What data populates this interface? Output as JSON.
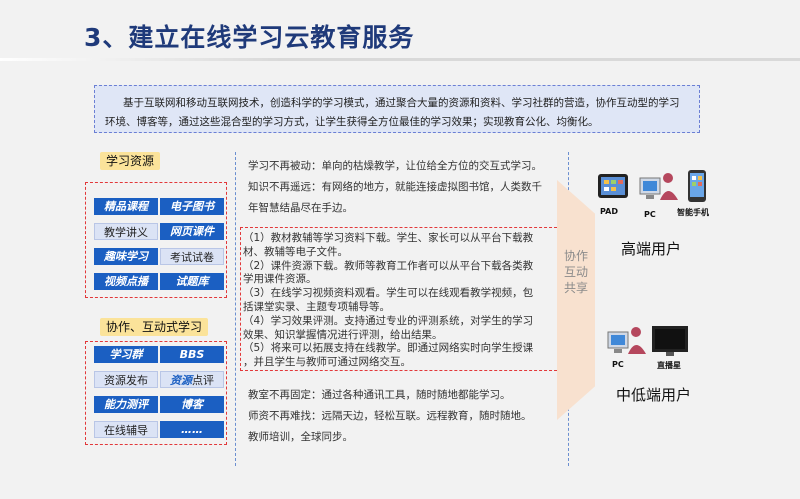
{
  "title": "3、建立在线学习云教育服务",
  "intro": "基于互联网和移动互联网技术，创造科学的学习模式，通过聚合大量的资源和资料、学习社群的营造，协作互动型的学习环境、博客等，通过这些混合型的学习方式，让学生获得全方位最佳的学习效果；实现教育公化、均衡化。",
  "left": {
    "resources_label": "学习资源",
    "resources": [
      {
        "text": "精品课程",
        "style": "strong"
      },
      {
        "text": "电子图书",
        "style": "strong"
      },
      {
        "text": "教学讲义",
        "style": "light"
      },
      {
        "text": "网页课件",
        "style": "strong"
      },
      {
        "text": "趣味学习",
        "style": "strong"
      },
      {
        "text": "考试试卷",
        "style": "light"
      },
      {
        "text": "视频点播",
        "style": "strong"
      },
      {
        "text": "试题库",
        "style": "strong"
      }
    ],
    "collab_label": "协作、互动式学习",
    "collab": [
      {
        "text": "学习群",
        "style": "strong"
      },
      {
        "text": "BBS",
        "style": "strong"
      },
      {
        "text": "资源发布",
        "style": "light"
      },
      {
        "text": "资源点评",
        "style": "split",
        "bold_part": "资源",
        "rest": "点评"
      },
      {
        "text": "能力测评",
        "style": "strong"
      },
      {
        "text": "博客",
        "style": "strong"
      },
      {
        "text": "在线辅导",
        "style": "light"
      },
      {
        "text": "……",
        "style": "strong"
      }
    ]
  },
  "middle": {
    "top_lines": [
      "学习不再被动：单向的枯燥教学，让位给全方位的交互式学习。",
      "知识不再遥远：有网络的地方，就能连接虚拟图书馆，人类数千",
      "年智慧结晶尽在手边。"
    ],
    "numbered_lines": [
      "（1）教材教辅等学习资料下载。学生、家长可以从平台下载教",
      "      材、教辅等电子文件。",
      "（2）课件资源下载。教师等教育工作者可以从平台下载各类教",
      "      学用课件资源。",
      "（3）在线学习视频资料观看。学生可以在线观看教学视频，包",
      "      括课堂实录、主题专项辅导等。",
      "（4）学习效果评测。支持通过专业的评测系统，对学生的学习",
      "      效果、知识掌握情况进行评测，给出结果。",
      "（5）将来可以拓展支持在线教学。即通过网络实时向学生授课",
      "      ，并且学生与教师可通过网络交互。"
    ],
    "bottom_lines": [
      "教室不再固定：通过各种通讯工具，随时随地都能学习。",
      "师资不再难找：远隔天边，轻松互联。远程教育，随时随地。",
      "教师培训，全球同步。"
    ]
  },
  "arrow_text": "协作互动共享",
  "right": {
    "high_devices": [
      "PAD",
      "PC",
      "智能手机"
    ],
    "high_label": "高端用户",
    "low_devices": [
      "PC",
      "直播星"
    ],
    "low_label": "中低端用户"
  },
  "colors": {
    "title": "#1f3a7a",
    "accent_blue": "#1b5fc2",
    "dashed_red": "#e2383a",
    "label_yellow": "#fbe39a"
  }
}
